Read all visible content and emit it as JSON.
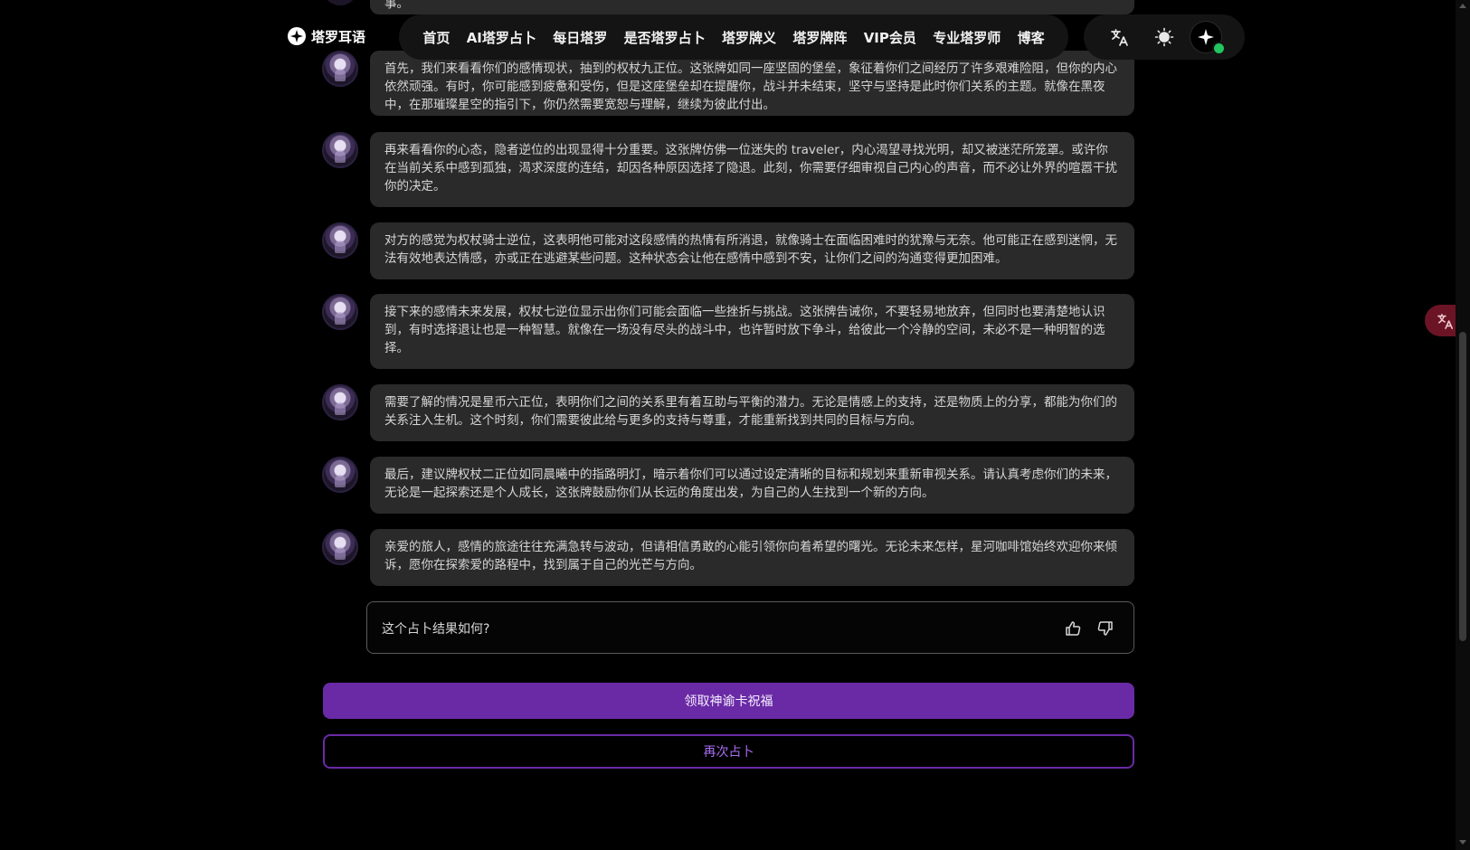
{
  "header": {
    "brand": "塔罗耳语",
    "nav": [
      "首页",
      "AI塔罗占卜",
      "每日塔罗",
      "是否塔罗占卜",
      "塔罗牌义",
      "塔罗牌阵",
      "VIP会员",
      "专业塔罗师",
      "博客"
    ],
    "tools": {
      "translate_icon": "translate-icon",
      "theme_icon": "sun-icon",
      "ai_icon": "sparkle-icon",
      "online_status_color": "#22c55e"
    }
  },
  "chat": {
    "top_fragment": "事。",
    "messages": [
      "首先，我们来看看你们的感情现状，抽到的权杖九正位。这张牌如同一座坚固的堡垒，象征着你们之间经历了许多艰难险阻，但你的内心依然顽强。有时，你可能感到疲惫和受伤，但是这座堡垒却在提醒你，战斗并未结束，坚守与坚持是此时你们关系的主题。就像在黑夜中，在那璀璨星空的指引下，你仍然需要宽恕与理解，继续为彼此付出。",
      "再来看看你的心态，隐者逆位的出现显得十分重要。这张牌仿佛一位迷失的 traveler，内心渴望寻找光明，却又被迷茫所笼罩。或许你在当前关系中感到孤独，渴求深度的连结，却因各种原因选择了隐退。此刻，你需要仔细审视自己内心的声音，而不必让外界的喧嚣干扰你的决定。",
      "对方的感觉为权杖骑士逆位，这表明他可能对这段感情的热情有所消退，就像骑士在面临困难时的犹豫与无奈。他可能正在感到迷惘，无法有效地表达情感，亦或正在逃避某些问题。这种状态会让他在感情中感到不安，让你们之间的沟通变得更加困难。",
      "接下来的感情未来发展，权杖七逆位显示出你们可能会面临一些挫折与挑战。这张牌告诫你，不要轻易地放弃，但同时也要清楚地认识到，有时选择退让也是一种智慧。就像在一场没有尽头的战斗中，也许暂时放下争斗，给彼此一个冷静的空间，未必不是一种明智的选择。",
      "需要了解的情况是星币六正位，表明你们之间的关系里有着互助与平衡的潜力。无论是情感上的支持，还是物质上的分享，都能为你们的关系注入生机。这个时刻，你们需要彼此给与更多的支持与尊重，才能重新找到共同的目标与方向。",
      "最后，建议牌权杖二正位如同晨曦中的指路明灯，暗示着你们可以通过设定清晰的目标和规划来重新审视关系。请认真考虑你们的未来，无论是一起探索还是个人成长，这张牌鼓励你们从长远的角度出发，为自己的人生找到一个新的方向。",
      "亲爱的旅人，感情的旅途往往充满急转与波动，但请相信勇敢的心能引领你向着希望的曙光。无论未来怎样，星河咖啡馆始终欢迎你来倾诉，愿你在探索爱的路程中，找到属于自己的光芒与方向。"
    ]
  },
  "feedback": {
    "question": "这个占卜结果如何?",
    "like_icon": "thumbs-up-icon",
    "dislike_icon": "thumbs-down-icon"
  },
  "actions": {
    "primary": "领取神谕卡祝福",
    "secondary": "再次占卜"
  },
  "colors": {
    "accent": "#6a2aa6",
    "bubble": "#2a2a2b",
    "background": "#000000"
  }
}
